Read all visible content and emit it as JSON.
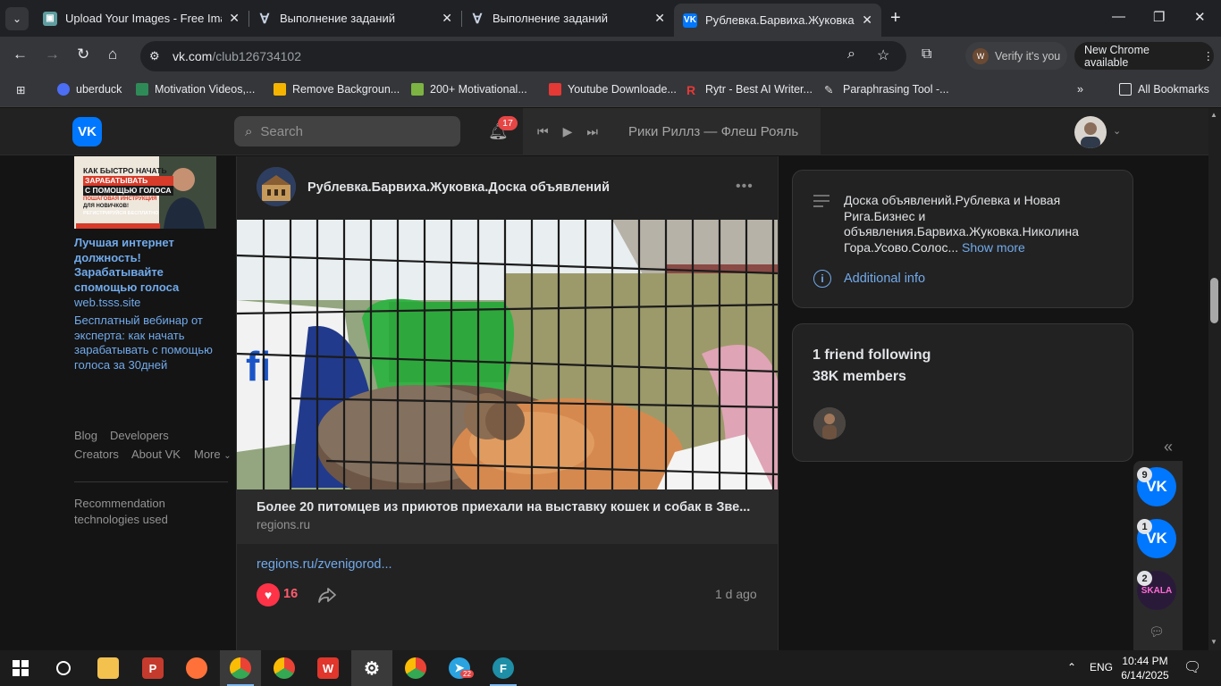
{
  "browser": {
    "tabs": [
      {
        "title": "Upload Your Images - Free Imag",
        "favicon": "image-icon",
        "active": false
      },
      {
        "title": "Выполнение заданий",
        "favicon": "v-icon",
        "active": false
      },
      {
        "title": "Выполнение заданий",
        "favicon": "v-icon",
        "active": false
      },
      {
        "title": "Рублевка.Барвиха.Жуковка.Дос",
        "favicon": "vk-icon",
        "active": true
      }
    ],
    "url_host": "vk.com",
    "url_path": "/club126734102",
    "verify_label": "Verify it's you",
    "verify_avatar": "W",
    "new_chrome_label": "New Chrome available",
    "bookmarks": [
      {
        "label": "uberduck",
        "color": "#4c6ef5"
      },
      {
        "label": "Motivation Videos,...",
        "color": "#2e8b57"
      },
      {
        "label": "Remove Backgroun...",
        "color": "#f4b400"
      },
      {
        "label": "200+ Motivational...",
        "color": "#7cb342"
      },
      {
        "label": "Youtube Downloade...",
        "color": "#e53935"
      },
      {
        "label": "Rytr - Best AI Writer...",
        "color": "#e53935"
      },
      {
        "label": "Paraphrasing Tool -...",
        "color": "#9e9e9e"
      }
    ],
    "all_bookmarks_label": "All Bookmarks"
  },
  "vk": {
    "logo_text": "VK",
    "search_placeholder": "Search",
    "notifications_count": "17",
    "player_track": "Рики Риллз — Флеш Рояль",
    "ad": {
      "image_lines": [
        "КАК БЫСТРО НАЧАТЬ",
        "ЗАРАБАТЫВАТЬ",
        "С ПОМОЩЬЮ ГОЛОСА",
        "ПОШАГОВАЯ ИНСТРУКЦИЯ",
        "ДЛЯ НОВИЧКОВ!",
        "РЕГИСТРИРУЙСЯ БЕСПЛАТНО"
      ],
      "title": "Лучшая интернет должность! Зарабатывайте спомощью голоса",
      "domain": "web.tsss.site",
      "description": "Бесплатный вебинар от эксперта: как начать зарабатывать с помощью голоса за 30дней"
    },
    "footer_links": [
      "Blog",
      "Developers",
      "Creators",
      "About VK",
      "More"
    ],
    "recommendation_text": "Recommendation technologies used",
    "post": {
      "author": "Рублевка.Барвиха.Жуковка.Доска объявлений",
      "link_title": "Более 20 питомцев из приютов приехали на выставку кошек и собак в Зве...",
      "link_domain": "regions.ru",
      "link_text": "regions.ru/zvenigorod...",
      "likes": "16",
      "time": "1 d ago"
    },
    "group": {
      "description": "Доска объявлений.Рублевка и Новая Рига.Бизнес и объявления.Барвиха.Жуковка.Николина Гора.Усово.Солос...",
      "show_more": "Show more",
      "additional_info": "Additional info",
      "friends_following": "1 friend following",
      "members": "38K members"
    },
    "chats": [
      {
        "badge": "9",
        "label": "VK"
      },
      {
        "badge": "1",
        "label": "VK"
      },
      {
        "badge": "2",
        "label": "SKALA"
      }
    ]
  },
  "taskbar": {
    "language": "ENG",
    "time": "10:44 PM",
    "date": "6/14/2025",
    "telegram_badge": "22"
  }
}
